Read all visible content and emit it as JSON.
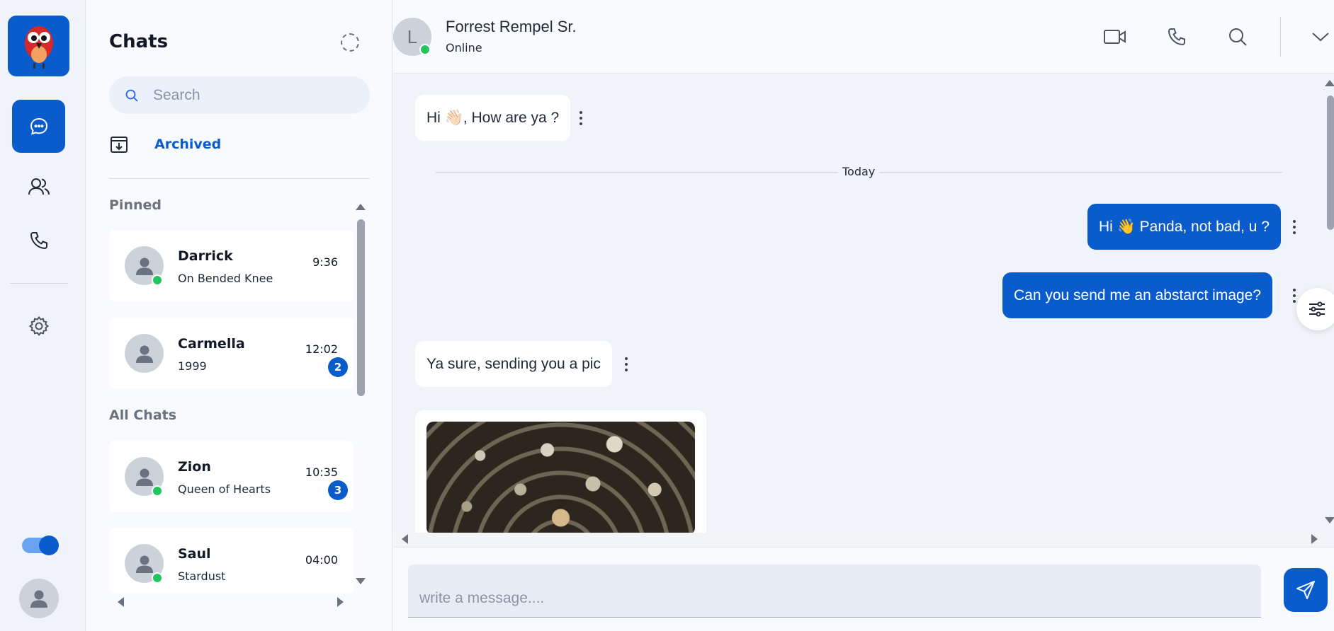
{
  "rail": {
    "logo_icon": "parrot-logo",
    "items": [
      {
        "icon": "chat-bubble-icon",
        "active": true
      },
      {
        "icon": "users-icon",
        "active": false
      },
      {
        "icon": "phone-icon",
        "active": false
      },
      {
        "icon": "gear-icon",
        "active": false
      }
    ],
    "dark_mode_toggle": true
  },
  "chat_list": {
    "title": "Chats",
    "search_placeholder": "Search",
    "archived_label": "Archived",
    "pinned_label": "Pinned",
    "all_chats_label": "All Chats",
    "pinned": [
      {
        "name": "Darrick",
        "message": "On Bended Knee",
        "time": "9:36",
        "online": true,
        "unread": ""
      },
      {
        "name": "Carmella",
        "message": "1999",
        "time": "12:02",
        "online": false,
        "unread": "2"
      }
    ],
    "all": [
      {
        "name": "Zion",
        "message": "Queen of Hearts",
        "time": "10:35",
        "online": true,
        "unread": "3"
      },
      {
        "name": "Saul",
        "message": "Stardust",
        "time": "04:00",
        "online": true,
        "unread": ""
      }
    ]
  },
  "conversation": {
    "contact_initial": "L",
    "contact_name": "Forrest Rempel Sr.",
    "contact_status": "Online",
    "header_icons": [
      "video-camera-icon",
      "phone-icon",
      "search-icon",
      "chevron-down-icon"
    ],
    "day_divider": "Today",
    "messages": [
      {
        "direction": "in",
        "text": "Hi 👋🏻, How are ya ?"
      },
      {
        "direction": "out",
        "text": "Hi 👋 Panda, not bad, u ?"
      },
      {
        "direction": "out",
        "text": "Can you send me an abstarct image?"
      },
      {
        "direction": "in",
        "text": "Ya sure, sending you a pic"
      }
    ],
    "composer_placeholder": "write a message...."
  },
  "colors": {
    "accent": "#0a5ccc",
    "online": "#22c55e",
    "background": "#f0f4fa"
  }
}
